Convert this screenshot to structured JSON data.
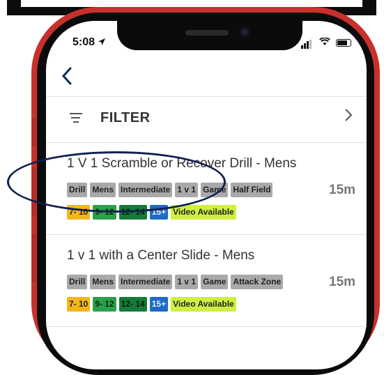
{
  "status_bar": {
    "time": "5:08"
  },
  "nav": {
    "back_icon": "chevron-left-icon"
  },
  "filter": {
    "label": "FILTER",
    "icon": "filter-lines-icon",
    "chevron": "chevron-right-icon"
  },
  "drills": [
    {
      "title": "1 V 1 Scramble or Recover Drill - Mens",
      "duration": "15m",
      "tags": [
        "Drill",
        "Mens",
        "Intermediate",
        "1 v 1",
        "Game",
        "Half Field"
      ],
      "age_tags": [
        "7- 10",
        "9- 12",
        "12- 14",
        "15+",
        "Video Available"
      ]
    },
    {
      "title": "1 v 1 with a Center Slide - Mens",
      "duration": "15m",
      "tags": [
        "Drill",
        "Mens",
        "Intermediate",
        "1 v 1",
        "Game",
        "Attack Zone"
      ],
      "age_tags": [
        "7- 10",
        "9- 12",
        "12- 14",
        "15+",
        "Video Available"
      ]
    }
  ],
  "colors": {
    "phone_frame": "#c8302c",
    "tag_gray": "#a9a9a9",
    "tag_yellow": "#f4b61c",
    "tag_green": "#2ba04a",
    "tag_dark_green": "#157a3a",
    "tag_blue": "#1e6bc4",
    "tag_lime": "#cff043",
    "annotation_ellipse": "#0f2150"
  }
}
